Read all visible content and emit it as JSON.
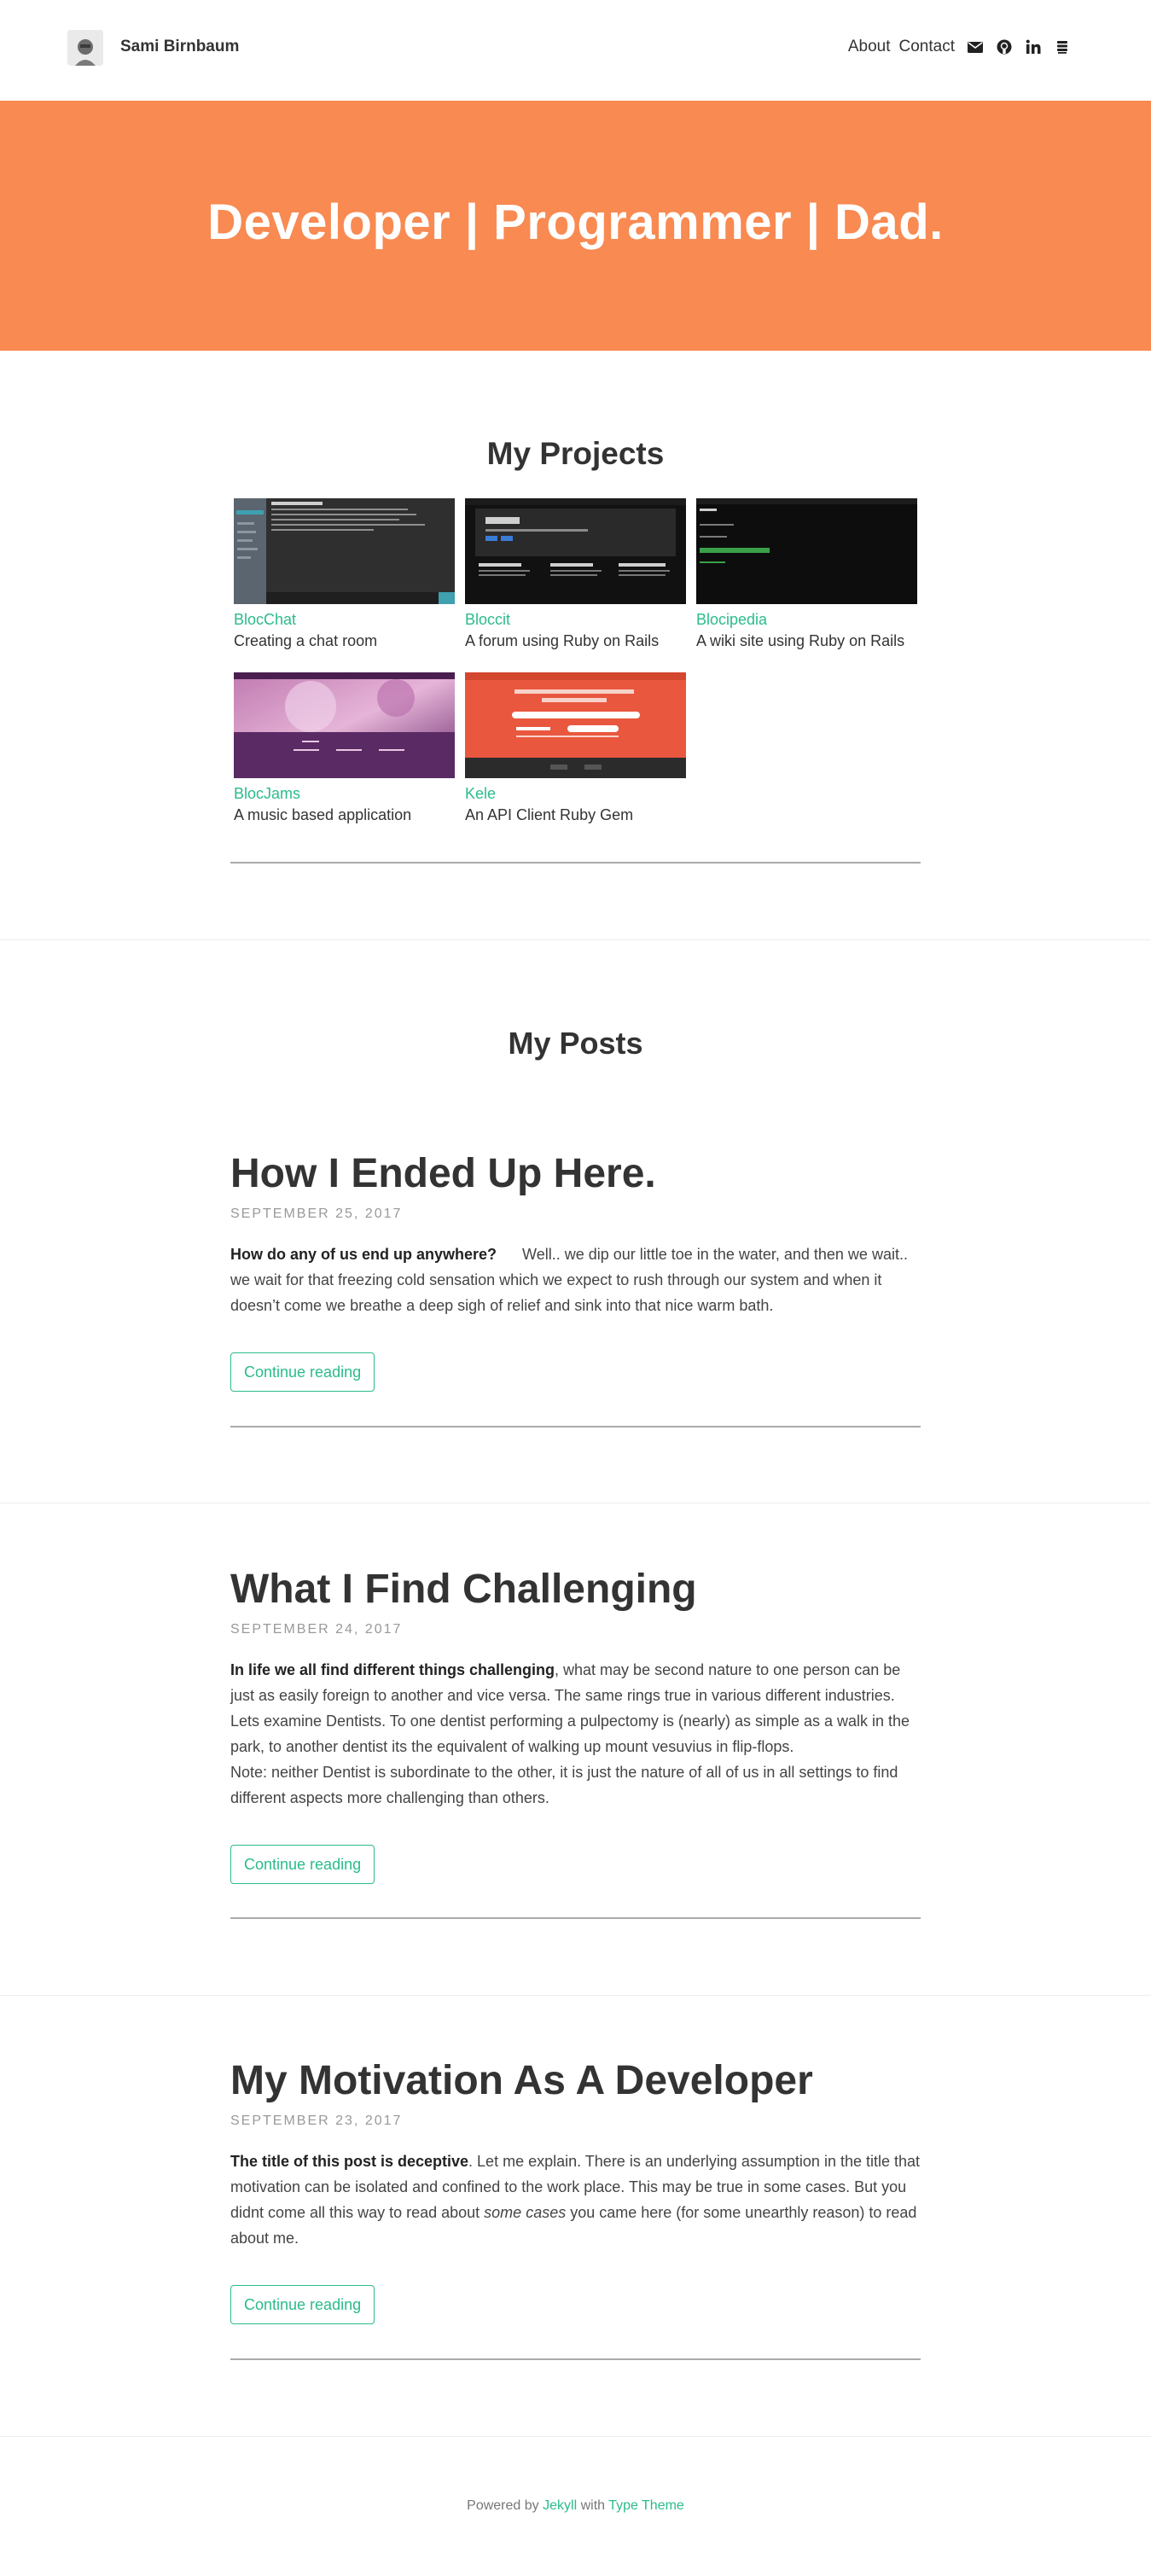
{
  "header": {
    "site_title": "Sami Birnbaum",
    "nav": {
      "about": "About",
      "contact": "Contact"
    },
    "icons": [
      "envelope-icon",
      "github-icon",
      "linkedin-icon",
      "stack-icon"
    ]
  },
  "hero": {
    "title": "Developer | Programmer | Dad."
  },
  "projects": {
    "heading": "My Projects",
    "items": [
      {
        "name": "BlocChat",
        "desc": "Creating a chat room"
      },
      {
        "name": "Bloccit",
        "desc": "A forum using Ruby on Rails"
      },
      {
        "name": "Blocipedia",
        "desc": "A wiki site using Ruby on Rails"
      },
      {
        "name": "BlocJams",
        "desc": "A music based application"
      },
      {
        "name": "Kele",
        "desc": "An API Client Ruby Gem"
      }
    ]
  },
  "posts": {
    "heading": "My Posts",
    "items": [
      {
        "title": "How I Ended Up Here.",
        "date": "SEPTEMBER 25, 2017",
        "lead": "How do any of us end up anywhere?",
        "body": "Well.. we dip our little toe in the water, and then we wait.. we wait for that freezing cold sensation which we expect to rush through our system and when it doesn’t come we breathe a deep sigh of relief and sink into that nice warm bath.",
        "button": "Continue reading"
      },
      {
        "title": "What I Find Challenging",
        "date": "SEPTEMBER 24, 2017",
        "lead": "In life we all find different things challenging",
        "body": ", what may be second nature to one person can be just as easily foreign to another and vice versa. The same rings true in various different industries. Lets examine Dentists. To one dentist performing a pulpectomy is (nearly) as simple as a walk in the park, to another dentist its the equivalent of walking up mount vesuvius in flip-flops.",
        "note": "Note: neither Dentist is subordinate to the other, it is just the nature of all of us in all settings to find different aspects more challenging than others.",
        "button": "Continue reading"
      },
      {
        "title": "My Motivation As A Developer",
        "date": "SEPTEMBER 23, 2017",
        "lead": "The title of this post is deceptive",
        "body": ". Let me explain. There is an underlying assumption in the title that motivation can be isolated and confined to the work place. This may be true in some cases. But you didnt come all this way to read about ",
        "emph": "some cases",
        "body_end": " you came here (for some unearthly reason) to read about me.",
        "button": "Continue reading"
      }
    ]
  },
  "footer": {
    "prefix": "Powered by",
    "link1": "Jekyll",
    "middle": "with",
    "link2": "Type Theme"
  },
  "colors": {
    "accent": "#2bbc8a",
    "hero": "#f88a52"
  }
}
